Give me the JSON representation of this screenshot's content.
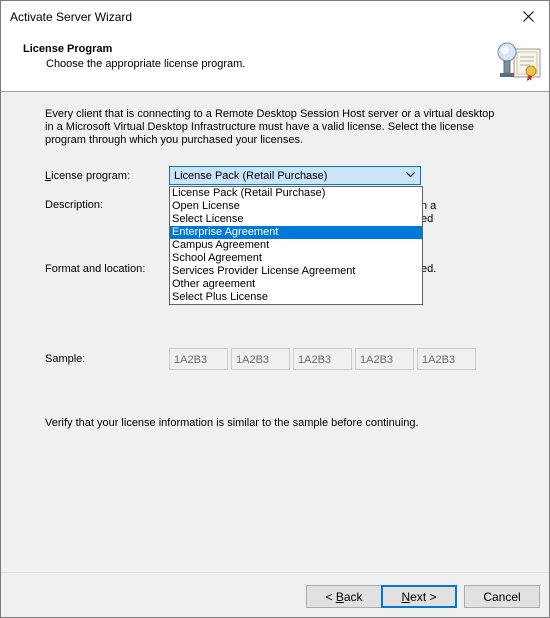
{
  "window": {
    "title": "Activate Server Wizard"
  },
  "header": {
    "title": "License Program",
    "subtitle": "Choose the appropriate license program."
  },
  "intro": "Every client that is connecting to a Remote Desktop Session Host server or a virtual desktop in a Microsoft Virtual Desktop Infrastructure must have a valid license. Select the license program through which you purchased your licenses.",
  "license_program": {
    "label": "License program:",
    "selected": "License Pack (Retail Purchase)",
    "highlighted": "Enterprise Agreement",
    "options": [
      "License Pack (Retail Purchase)",
      "Open License",
      "Select License",
      "Enterprise Agreement",
      "Campus Agreement",
      "School Agreement",
      "Services Provider License Agreement",
      "Other agreement",
      "Select Plus License"
    ]
  },
  "description": {
    "label": "Description:",
    "tail1": "n a",
    "tail2": "ed"
  },
  "format": {
    "label": "Format and location:",
    "tail": "ed."
  },
  "sample": {
    "label": "Sample:",
    "boxes": [
      "1A2B3",
      "1A2B3",
      "1A2B3",
      "1A2B3",
      "1A2B3"
    ]
  },
  "verify": "Verify that your license information is similar to the sample before continuing.",
  "buttons": {
    "back": "Back",
    "back_accel": "B",
    "next": "Next >",
    "next_accel": "N",
    "cancel": "Cancel"
  }
}
